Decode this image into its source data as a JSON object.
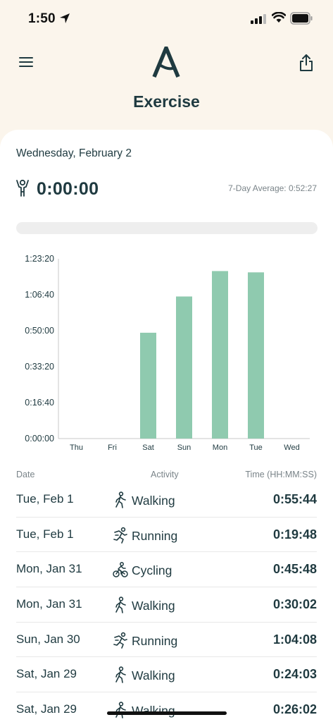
{
  "status": {
    "time": "1:50"
  },
  "header": {
    "title": "Exercise"
  },
  "summary": {
    "date": "Wednesday, February 2",
    "today_total": "0:00:00",
    "seven_day_average": "7-Day Average: 0:52:27",
    "progress_fraction": 0
  },
  "colors": {
    "accent": "#8fcaaf",
    "text": "#1f3a40",
    "background": "#fbf5ec",
    "muted": "#7a8489"
  },
  "chart_data": {
    "type": "bar",
    "categories": [
      "Thu",
      "Fri",
      "Sat",
      "Sun",
      "Mon",
      "Tue",
      "Wed"
    ],
    "values_seconds": [
      0,
      0,
      2943,
      3951,
      4658,
      4622,
      0
    ],
    "y_ticks": [
      "0:00:00",
      "0:16:40",
      "0:33:20",
      "0:50:00",
      "1:06:40",
      "1:23:20"
    ],
    "ylim_seconds": [
      0,
      5000
    ],
    "grid": false
  },
  "table": {
    "headers": {
      "date": "Date",
      "activity": "Activity",
      "time": "Time (HH:MM:SS)"
    },
    "rows": [
      {
        "date": "Tue, Feb 1",
        "activity": "Walking",
        "icon": "walking-icon",
        "time": "0:55:44"
      },
      {
        "date": "Tue, Feb 1",
        "activity": "Running",
        "icon": "running-icon",
        "time": "0:19:48"
      },
      {
        "date": "Mon, Jan 31",
        "activity": "Cycling",
        "icon": "cycling-icon",
        "time": "0:45:48"
      },
      {
        "date": "Mon, Jan 31",
        "activity": "Walking",
        "icon": "walking-icon",
        "time": "0:30:02"
      },
      {
        "date": "Sun, Jan 30",
        "activity": "Running",
        "icon": "running-icon",
        "time": "1:04:08"
      },
      {
        "date": "Sat, Jan 29",
        "activity": "Walking",
        "icon": "walking-icon",
        "time": "0:24:03"
      },
      {
        "date": "Sat, Jan 29",
        "activity": "Walking",
        "icon": "walking-icon",
        "time": "0:26:02"
      }
    ]
  }
}
